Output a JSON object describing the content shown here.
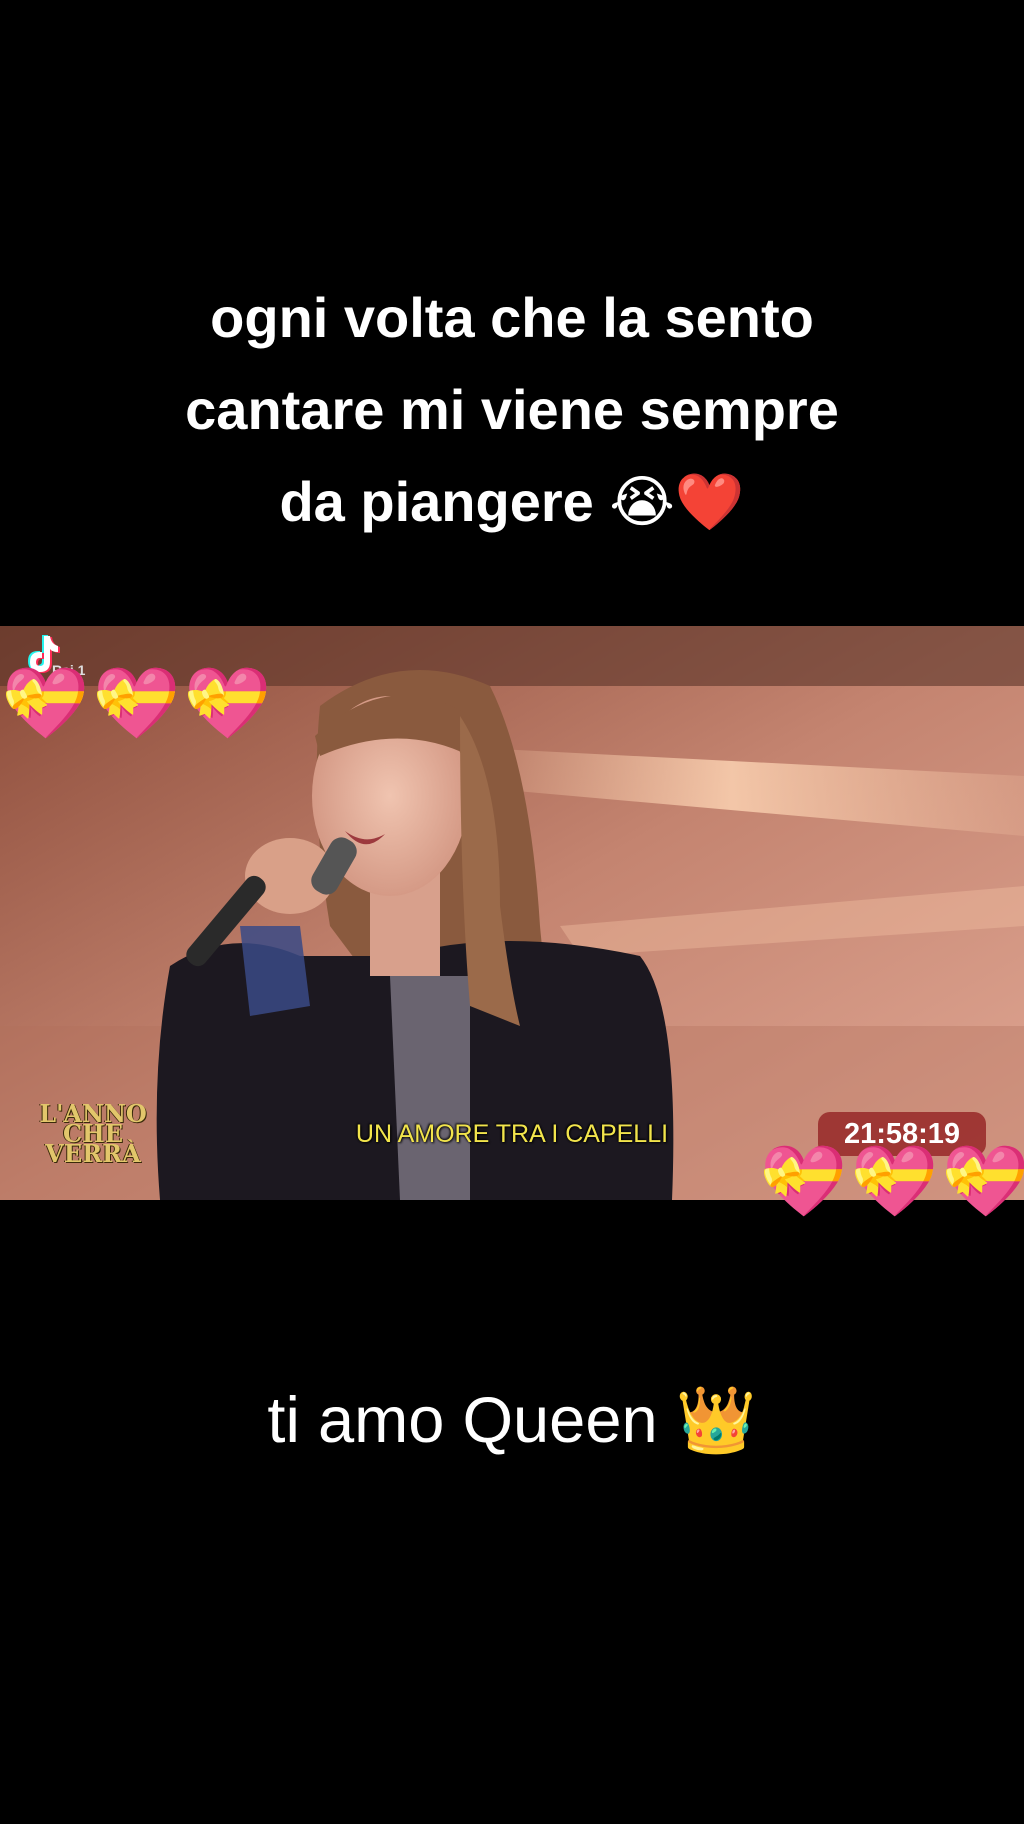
{
  "overlay": {
    "top_caption_lines": [
      "ogni volta che la sento",
      "cantare mi viene sempre",
      "da piangere 😭❤️"
    ],
    "bottom_caption": "ti amo Queen 👑",
    "heart_emoji": "💝"
  },
  "video": {
    "subtitle": "UN AMORE TRA I CAPELLI",
    "clock": "21:58:19",
    "show_logo": [
      "L'ANNO",
      "CHE",
      "VERRÀ"
    ],
    "channel_logo": "Rai 1",
    "watermark_icon": "tiktok-icon"
  },
  "colors": {
    "background": "#000000",
    "subtitle": "#f2e44c",
    "clock_bg": "#962828",
    "show_logo": "#e2c66b"
  }
}
